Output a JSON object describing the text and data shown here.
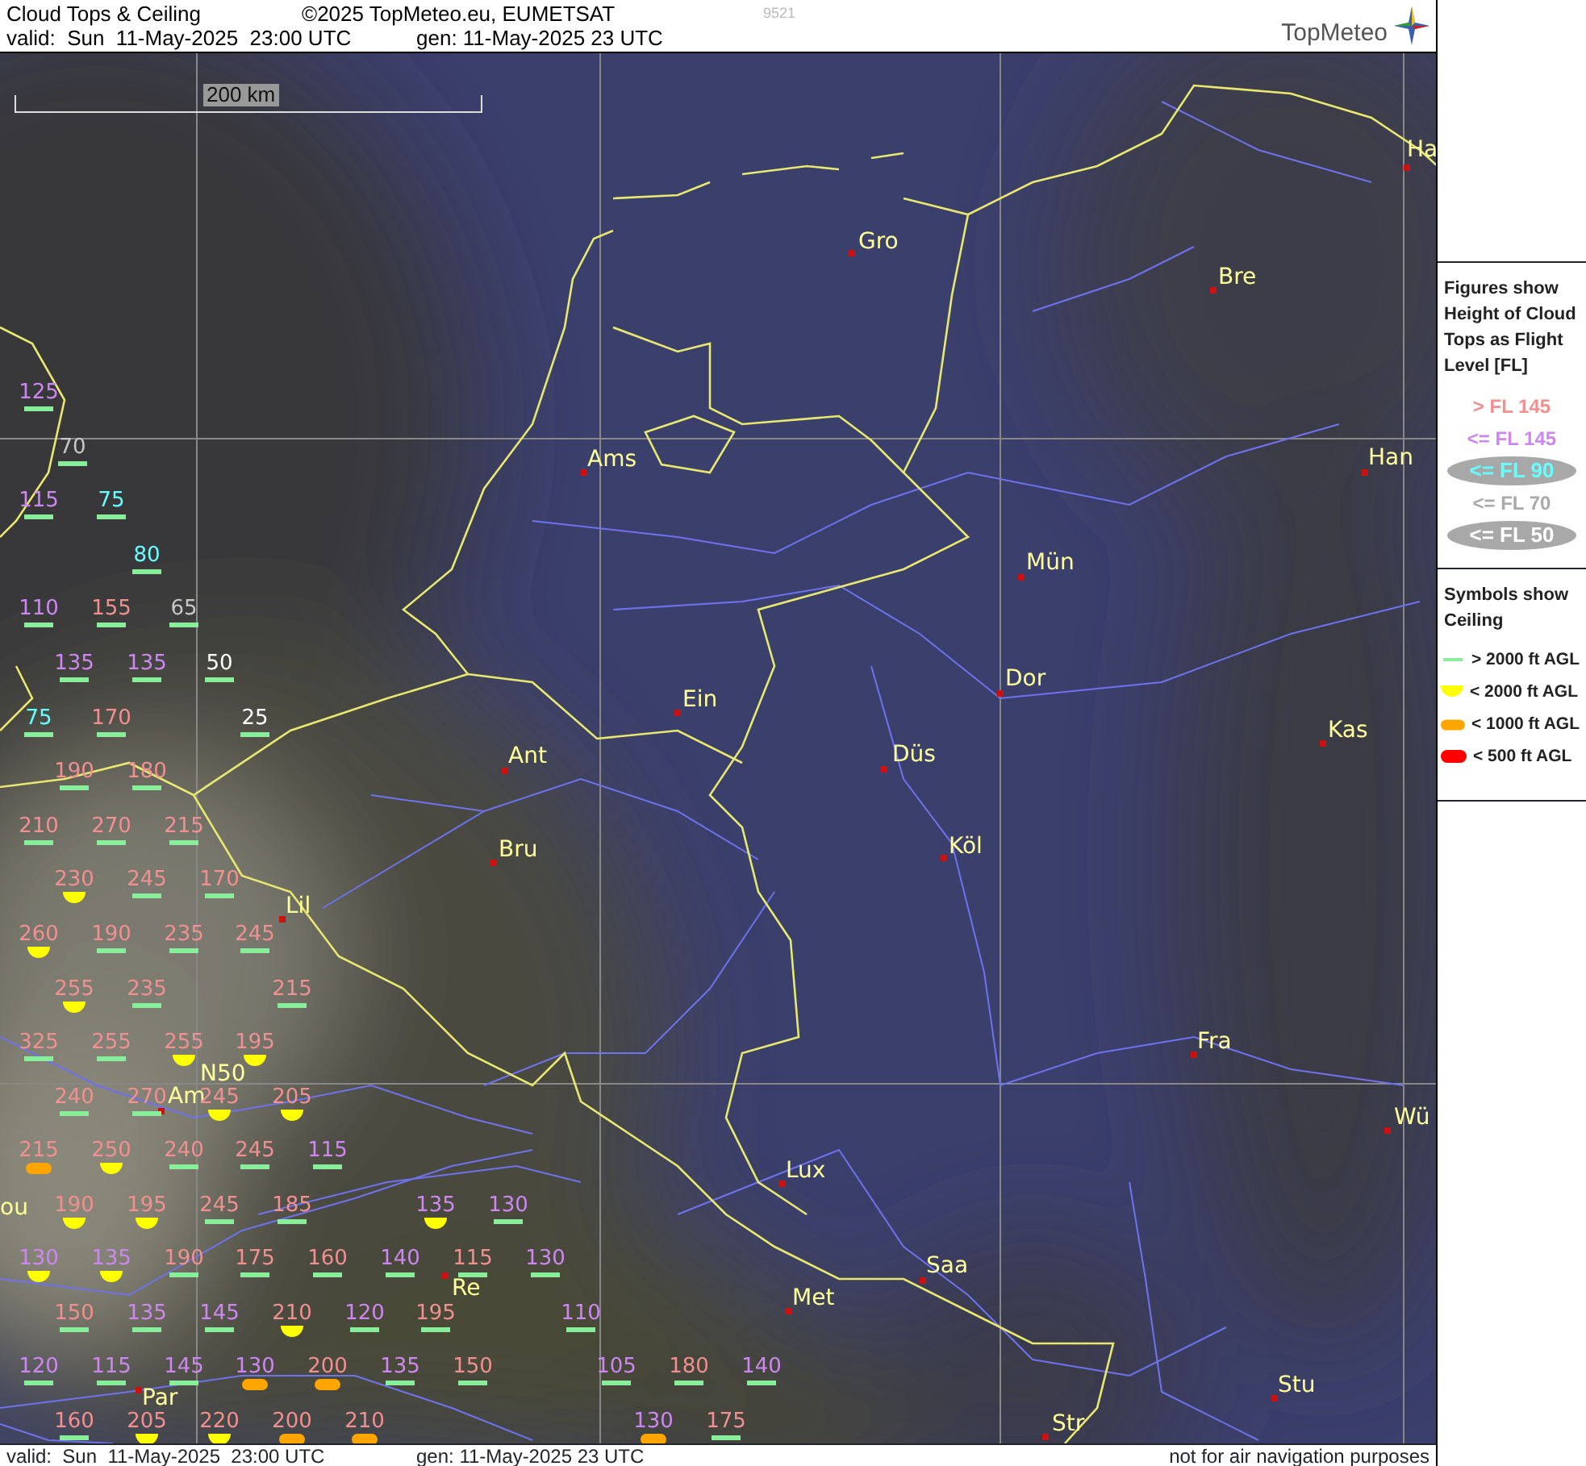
{
  "header": {
    "title": "Cloud Tops & Ceiling",
    "copyright": "©2025 TopMeteo.eu, EUMETSAT",
    "code": "9521",
    "valid": "valid:  Sun  11-May-2025  23:00 UTC",
    "generated": "gen: 11-May-2025 23 UTC",
    "logo": "TopMeteo"
  },
  "map": {
    "scale_label": "200 km",
    "places": [
      {
        "name": "Ha",
        "kind": "city"
      },
      {
        "name": "Gro",
        "kind": "city"
      },
      {
        "name": "Bre",
        "kind": "city"
      },
      {
        "name": "Ams",
        "kind": "city"
      },
      {
        "name": "Han",
        "kind": "city"
      },
      {
        "name": "Mün",
        "kind": "city"
      },
      {
        "name": "Dor",
        "kind": "city"
      },
      {
        "name": "Ein",
        "kind": "city"
      },
      {
        "name": "Kas",
        "kind": "city"
      },
      {
        "name": "Düs",
        "kind": "city"
      },
      {
        "name": "Ant",
        "kind": "city"
      },
      {
        "name": "Köl",
        "kind": "city"
      },
      {
        "name": "Bru",
        "kind": "city"
      },
      {
        "name": "Lil",
        "kind": "city"
      },
      {
        "name": "Fra",
        "kind": "city"
      },
      {
        "name": "N50",
        "kind": "label"
      },
      {
        "name": "Am",
        "kind": "city"
      },
      {
        "name": "Wü",
        "kind": "city"
      },
      {
        "name": "Lux",
        "kind": "city"
      },
      {
        "name": "ou",
        "kind": "label"
      },
      {
        "name": "Re",
        "kind": "city"
      },
      {
        "name": "Saa",
        "kind": "city"
      },
      {
        "name": "Met",
        "kind": "city"
      },
      {
        "name": "Par",
        "kind": "city"
      },
      {
        "name": "Stu",
        "kind": "city"
      },
      {
        "name": "Str",
        "kind": "city"
      }
    ],
    "observations": [
      {
        "value": "125",
        "color": "#cc88f0",
        "kind": "over2000"
      },
      {
        "value": "70",
        "color": "#c8c8c8",
        "kind": "over2000"
      },
      {
        "value": "115",
        "color": "#cc88f0",
        "kind": "over2000"
      },
      {
        "value": "75",
        "color": "#66ffff",
        "kind": "over2000"
      },
      {
        "value": "80",
        "color": "#66ffff",
        "kind": "over2000"
      },
      {
        "value": "110",
        "color": "#cc88f0",
        "kind": "over2000"
      },
      {
        "value": "155",
        "color": "#f19090",
        "kind": "over2000"
      },
      {
        "value": "65",
        "color": "#c8c8c8",
        "kind": "over2000"
      },
      {
        "value": "135",
        "color": "#cc88f0",
        "kind": "over2000"
      },
      {
        "value": "135",
        "color": "#cc88f0",
        "kind": "over2000"
      },
      {
        "value": "50",
        "color": "#ffffff",
        "kind": "over2000"
      },
      {
        "value": "75",
        "color": "#66ffff",
        "kind": "over2000"
      },
      {
        "value": "170",
        "color": "#f19090",
        "kind": "over2000"
      },
      {
        "value": "25",
        "color": "#ffffff",
        "kind": "over2000"
      },
      {
        "value": "190",
        "color": "#f19090",
        "kind": "over2000"
      },
      {
        "value": "180",
        "color": "#f19090",
        "kind": "over2000"
      },
      {
        "value": "210",
        "color": "#f19090",
        "kind": "over2000"
      },
      {
        "value": "270",
        "color": "#f19090",
        "kind": "over2000"
      },
      {
        "value": "215",
        "color": "#f19090",
        "kind": "over2000"
      },
      {
        "value": "230",
        "color": "#f19090",
        "kind": "under2000"
      },
      {
        "value": "245",
        "color": "#f19090",
        "kind": "over2000"
      },
      {
        "value": "170",
        "color": "#f19090",
        "kind": "over2000"
      },
      {
        "value": "260",
        "color": "#f19090",
        "kind": "under2000"
      },
      {
        "value": "190",
        "color": "#f19090",
        "kind": "over2000"
      },
      {
        "value": "235",
        "color": "#f19090",
        "kind": "over2000"
      },
      {
        "value": "245",
        "color": "#f19090",
        "kind": "over2000"
      },
      {
        "value": "255",
        "color": "#f19090",
        "kind": "under2000"
      },
      {
        "value": "235",
        "color": "#f19090",
        "kind": "over2000"
      },
      {
        "value": "215",
        "color": "#f19090",
        "kind": "over2000"
      },
      {
        "value": "325",
        "color": "#f19090",
        "kind": "over2000"
      },
      {
        "value": "255",
        "color": "#f19090",
        "kind": "over2000"
      },
      {
        "value": "255",
        "color": "#f19090",
        "kind": "under2000"
      },
      {
        "value": "195",
        "color": "#f19090",
        "kind": "under2000"
      },
      {
        "value": "240",
        "color": "#f19090",
        "kind": "over2000"
      },
      {
        "value": "270",
        "color": "#f19090",
        "kind": "over2000"
      },
      {
        "value": "245",
        "color": "#f19090",
        "kind": "under2000"
      },
      {
        "value": "205",
        "color": "#f19090",
        "kind": "under2000"
      },
      {
        "value": "215",
        "color": "#f19090",
        "kind": "under1000"
      },
      {
        "value": "250",
        "color": "#f19090",
        "kind": "under2000"
      },
      {
        "value": "240",
        "color": "#f19090",
        "kind": "over2000"
      },
      {
        "value": "245",
        "color": "#f19090",
        "kind": "over2000"
      },
      {
        "value": "115",
        "color": "#cc88f0",
        "kind": "over2000"
      },
      {
        "value": "190",
        "color": "#f19090",
        "kind": "under2000"
      },
      {
        "value": "195",
        "color": "#f19090",
        "kind": "under2000"
      },
      {
        "value": "245",
        "color": "#f19090",
        "kind": "over2000"
      },
      {
        "value": "185",
        "color": "#f19090",
        "kind": "over2000"
      },
      {
        "value": "135",
        "color": "#cc88f0",
        "kind": "under2000"
      },
      {
        "value": "130",
        "color": "#cc88f0",
        "kind": "over2000"
      },
      {
        "value": "130",
        "color": "#cc88f0",
        "kind": "under2000"
      },
      {
        "value": "135",
        "color": "#cc88f0",
        "kind": "under2000"
      },
      {
        "value": "190",
        "color": "#f19090",
        "kind": "over2000"
      },
      {
        "value": "175",
        "color": "#f19090",
        "kind": "over2000"
      },
      {
        "value": "160",
        "color": "#f19090",
        "kind": "over2000"
      },
      {
        "value": "140",
        "color": "#cc88f0",
        "kind": "over2000"
      },
      {
        "value": "115",
        "color": "#f19090",
        "kind": "over2000"
      },
      {
        "value": "130",
        "color": "#cc88f0",
        "kind": "over2000"
      },
      {
        "value": "150",
        "color": "#f19090",
        "kind": "over2000"
      },
      {
        "value": "135",
        "color": "#cc88f0",
        "kind": "over2000"
      },
      {
        "value": "145",
        "color": "#cc88f0",
        "kind": "over2000"
      },
      {
        "value": "210",
        "color": "#f19090",
        "kind": "under2000"
      },
      {
        "value": "120",
        "color": "#cc88f0",
        "kind": "over2000"
      },
      {
        "value": "195",
        "color": "#f19090",
        "kind": "over2000"
      },
      {
        "value": "110",
        "color": "#cc88f0",
        "kind": "over2000"
      },
      {
        "value": "120",
        "color": "#cc88f0",
        "kind": "over2000"
      },
      {
        "value": "115",
        "color": "#cc88f0",
        "kind": "over2000"
      },
      {
        "value": "145",
        "color": "#cc88f0",
        "kind": "over2000"
      },
      {
        "value": "130",
        "color": "#cc88f0",
        "kind": "under1000"
      },
      {
        "value": "200",
        "color": "#f19090",
        "kind": "under1000"
      },
      {
        "value": "135",
        "color": "#cc88f0",
        "kind": "over2000"
      },
      {
        "value": "150",
        "color": "#f19090",
        "kind": "over2000"
      },
      {
        "value": "105",
        "color": "#cc88f0",
        "kind": "over2000"
      },
      {
        "value": "180",
        "color": "#f19090",
        "kind": "over2000"
      },
      {
        "value": "140",
        "color": "#cc88f0",
        "kind": "over2000"
      },
      {
        "value": "160",
        "color": "#f19090",
        "kind": "over2000"
      },
      {
        "value": "205",
        "color": "#f19090",
        "kind": "under2000"
      },
      {
        "value": "220",
        "color": "#f19090",
        "kind": "under2000"
      },
      {
        "value": "200",
        "color": "#f19090",
        "kind": "under1000"
      },
      {
        "value": "210",
        "color": "#f19090",
        "kind": "under1000"
      },
      {
        "value": "130",
        "color": "#cc88f0",
        "kind": "under1000"
      },
      {
        "value": "175",
        "color": "#f19090",
        "kind": "over2000"
      }
    ]
  },
  "legend": {
    "figures_title": "Figures show Height of Cloud Tops as Flight Level  [FL]",
    "bands": [
      {
        "label": "> FL 145",
        "kind": "above145",
        "highlighted": false
      },
      {
        "label": "<= FL 145",
        "kind": "upto145",
        "highlighted": false
      },
      {
        "label": "<= FL 90",
        "kind": "upto90",
        "highlighted": true
      },
      {
        "label": "<= FL 70",
        "kind": "upto70",
        "highlighted": false
      },
      {
        "label": "<= FL 50",
        "kind": "upto50",
        "highlighted": true
      }
    ],
    "symbols_title": "Symbols show Ceiling",
    "ceilings": [
      {
        "label": "> 2000 ft AGL",
        "kind": "over2000"
      },
      {
        "label": "< 2000 ft AGL",
        "kind": "under2000"
      },
      {
        "label": "< 1000 ft AGL",
        "kind": "under1000"
      },
      {
        "label": "< 500 ft AGL",
        "kind": "under500"
      }
    ]
  },
  "footer": {
    "valid": "valid:  Sun  11-May-2025  23:00 UTC",
    "generated": "gen: 11-May-2025 23 UTC",
    "disclaimer": "not for air navigation purposes"
  }
}
